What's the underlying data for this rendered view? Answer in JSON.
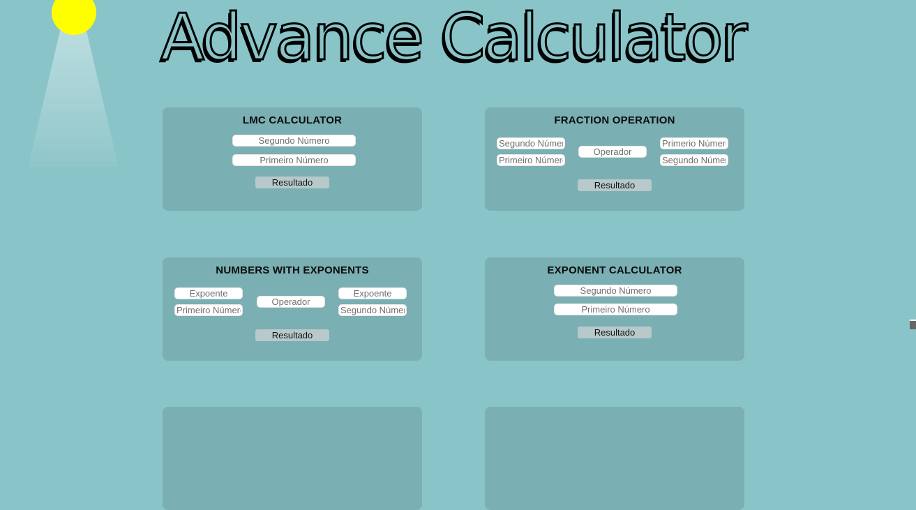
{
  "title": "Advance Calculator",
  "cards": {
    "lmc": {
      "title": "LMC CALCULATOR",
      "second_placeholder": "Segundo Número",
      "first_placeholder": "Primeiro Número",
      "result_label": "Resultado"
    },
    "fraction": {
      "title": "FRACTION OPERATION",
      "left_top_placeholder": "Segundo Número",
      "left_bottom_placeholder": "Primeiro Número",
      "operator_placeholder": "Operador",
      "right_top_placeholder": "Primerio Número",
      "right_bottom_placeholder": "Segundo Número",
      "result_label": "Resultado"
    },
    "numbers_exponents": {
      "title": "NUMBERS WITH EXPONENTS",
      "left_top_placeholder": "Expoente",
      "left_bottom_placeholder": "Primeiro Número",
      "operator_placeholder": "Operador",
      "right_top_placeholder": "Expoente",
      "right_bottom_placeholder": "Segundo Número",
      "result_label": "Resultado"
    },
    "exponent": {
      "title": "EXPONENT CALCULATOR",
      "second_placeholder": "Segundo Número",
      "first_placeholder": "Primeiro Número",
      "result_label": "Resultado"
    }
  }
}
